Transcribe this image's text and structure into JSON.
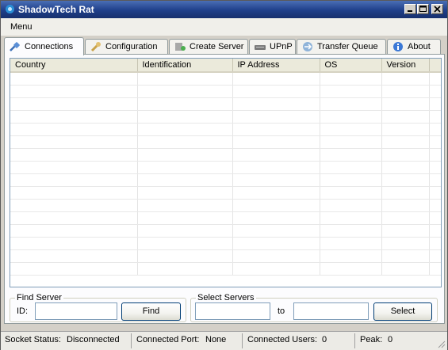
{
  "window": {
    "title": "ShadowTech Rat"
  },
  "menu": {
    "items": [
      "Menu"
    ]
  },
  "tabs": [
    {
      "label": "Connections",
      "icon": "plug-icon",
      "active": true
    },
    {
      "label": "Configuration",
      "icon": "wrench-icon",
      "active": false
    },
    {
      "label": "Create Server",
      "icon": "server-build-icon",
      "active": false
    },
    {
      "label": "UPnP",
      "icon": "router-icon",
      "active": false
    },
    {
      "label": "Transfer Queue",
      "icon": "transfer-icon",
      "active": false
    },
    {
      "label": "About",
      "icon": "info-icon",
      "active": false
    }
  ],
  "table": {
    "columns": [
      "Country",
      "Identification",
      "IP Address",
      "OS",
      "Version"
    ],
    "rows": []
  },
  "find_server": {
    "legend": "Find Server",
    "id_label": "ID:",
    "id_value": "",
    "button": "Find"
  },
  "select_servers": {
    "legend": "Select Servers",
    "to_label": "to",
    "from_value": "",
    "to_value": "",
    "button": "Select"
  },
  "status": {
    "socket_label": "Socket Status:",
    "socket_value": "Disconnected",
    "port_label": "Connected Port:",
    "port_value": "None",
    "users_label": "Connected Users:",
    "users_value": "0",
    "peak_label": "Peak:",
    "peak_value": "0"
  },
  "colors": {
    "titlebar": "#1f3f8a",
    "face": "#d4d0c8",
    "button_border": "#003c74"
  }
}
